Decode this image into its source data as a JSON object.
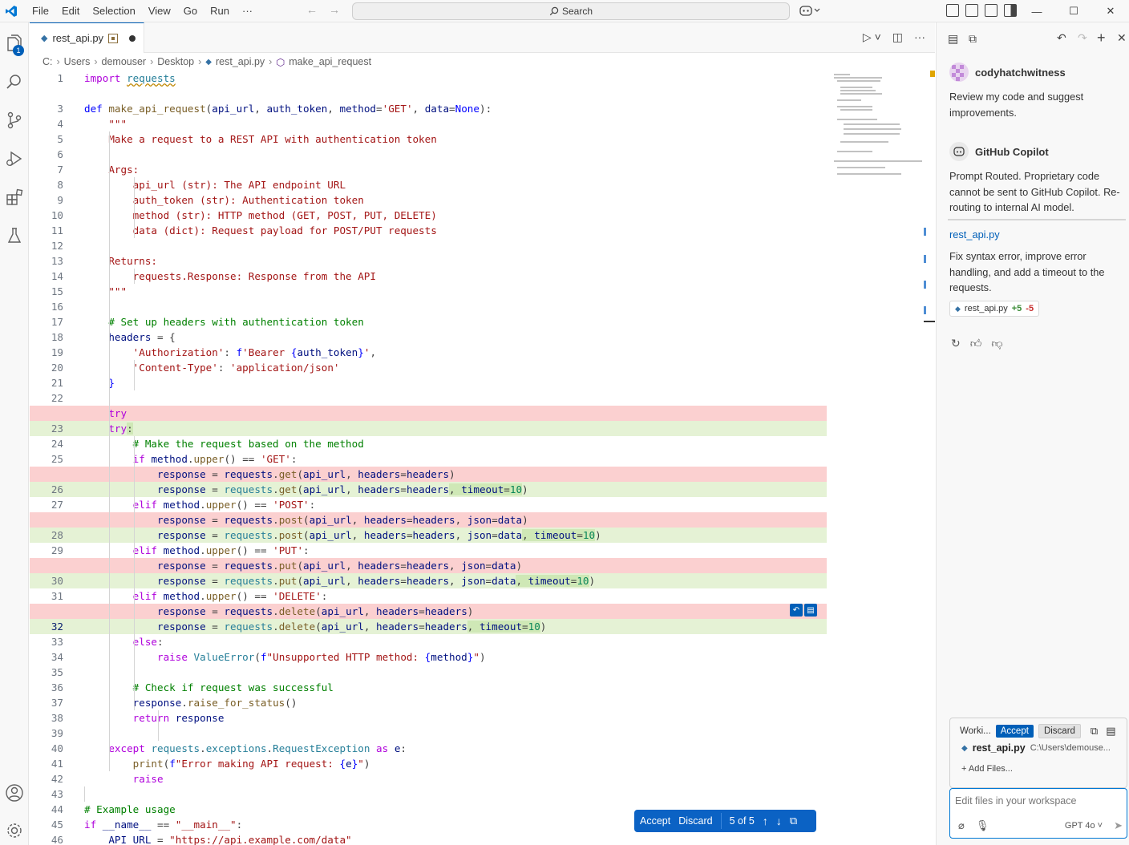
{
  "menu": [
    "File",
    "Edit",
    "Selection",
    "View",
    "Go",
    "Run",
    "···"
  ],
  "search": {
    "label": "Search"
  },
  "activity": {
    "explorer_badge": "1"
  },
  "tab": {
    "filename": "rest_api.py"
  },
  "breadcrumb": [
    "C:",
    "Users",
    "demouser",
    "Desktop",
    "rest_api.py",
    "make_api_request"
  ],
  "code": [
    {
      "n": "1",
      "t": "plain",
      "h": "<span class=\"kw\">import</span> <span class=\"cls squiggle\">requests</span>"
    },
    {
      "n": "",
      "t": "blank",
      "h": ""
    },
    {
      "n": "3",
      "t": "plain",
      "h": "<span class=\"kwb\">def</span> <span class=\"fn\">make_api_request</span>(<span class=\"var\">api_url</span>, <span class=\"var\">auth_token</span>, <span class=\"var\">method</span>=<span class=\"str\">'GET'</span>, <span class=\"var\">data</span>=<span class=\"kwb\">None</span>):"
    },
    {
      "n": "4",
      "t": "plain",
      "h": "    <span class=\"str\">\"\"\"</span>"
    },
    {
      "n": "5",
      "t": "plain",
      "h": "    <span class=\"str\">Make a request to a REST API with authentication token</span>"
    },
    {
      "n": "6",
      "t": "plain",
      "h": ""
    },
    {
      "n": "7",
      "t": "plain",
      "h": "    <span class=\"str\">Args:</span>"
    },
    {
      "n": "8",
      "t": "plain",
      "h": "        <span class=\"str\">api_url (str): The API endpoint URL</span>"
    },
    {
      "n": "9",
      "t": "plain",
      "h": "        <span class=\"str\">auth_token (str): Authentication token</span>"
    },
    {
      "n": "10",
      "t": "plain",
      "h": "        <span class=\"str\">method (str): HTTP method (GET, POST, PUT, DELETE)</span>"
    },
    {
      "n": "11",
      "t": "plain",
      "h": "        <span class=\"str\">data (dict): Request payload for POST/PUT requests</span>"
    },
    {
      "n": "12",
      "t": "plain",
      "h": ""
    },
    {
      "n": "13",
      "t": "plain",
      "h": "    <span class=\"str\">Returns:</span>"
    },
    {
      "n": "14",
      "t": "plain",
      "h": "        <span class=\"str\">requests.Response: Response from the API</span>"
    },
    {
      "n": "15",
      "t": "plain",
      "h": "    <span class=\"str\">\"\"\"</span>"
    },
    {
      "n": "16",
      "t": "plain",
      "h": ""
    },
    {
      "n": "17",
      "t": "plain",
      "h": "    <span class=\"cmt\"># Set up headers with authentication token</span>"
    },
    {
      "n": "18",
      "t": "plain",
      "h": "    <span class=\"var\">headers</span> = {"
    },
    {
      "n": "19",
      "t": "plain",
      "h": "        <span class=\"str\">'Authorization'</span>: <span class=\"kwb\">f</span><span class=\"str\">'Bearer </span><span class=\"kwb\">{</span><span class=\"var\">auth_token</span><span class=\"kwb\">}</span><span class=\"str\">'</span>,"
    },
    {
      "n": "20",
      "t": "plain",
      "h": "        <span class=\"str\">'Content-Type'</span>: <span class=\"str\">'application/json'</span>"
    },
    {
      "n": "21",
      "t": "plain",
      "h": "    <span class=\"kwb\">}</span>"
    },
    {
      "n": "22",
      "t": "plain",
      "h": ""
    },
    {
      "n": "",
      "t": "del",
      "h": "    <span class=\"kw\">try</span>"
    },
    {
      "n": "23",
      "t": "add",
      "h": "    <span class=\"kw\">try</span><span class=\"hl-add\">:</span>"
    },
    {
      "n": "24",
      "t": "plain",
      "h": "        <span class=\"cmt\"># Make the request based on the method</span>"
    },
    {
      "n": "25",
      "t": "plain",
      "h": "        <span class=\"kw\">if</span> <span class=\"var\">method</span>.<span class=\"fn\">upper</span>() == <span class=\"str\">'GET'</span>:"
    },
    {
      "n": "",
      "t": "del",
      "h": "            <span class=\"var\">response</span> = <span class=\"var\">requests</span>.<span class=\"fn\">get</span>(<span class=\"var\">api_url</span>, <span class=\"var\">headers</span>=<span class=\"var\">headers</span>)"
    },
    {
      "n": "26",
      "t": "add",
      "h": "            <span class=\"var\">response</span> = <span class=\"cls\">requests</span>.<span class=\"fn\">get</span>(<span class=\"var\">api_url</span>, <span class=\"var\">headers</span>=<span class=\"var\">headers</span><span class=\"hl-add\">, <span class=\"var\">timeout</span>=<span class=\"num\">10</span></span>)"
    },
    {
      "n": "27",
      "t": "plain",
      "h": "        <span class=\"kw\">elif</span> <span class=\"var\">method</span>.<span class=\"fn\">upper</span>() == <span class=\"str\">'POST'</span>:"
    },
    {
      "n": "",
      "t": "del",
      "h": "            <span class=\"var\">response</span> = <span class=\"var\">requests</span>.<span class=\"fn\">post</span>(<span class=\"var\">api_url</span>, <span class=\"var\">headers</span>=<span class=\"var\">headers</span>, <span class=\"var\">json</span>=<span class=\"var\">data</span>)"
    },
    {
      "n": "28",
      "t": "add",
      "h": "            <span class=\"var\">response</span> = <span class=\"cls\">requests</span>.<span class=\"fn\">post</span>(<span class=\"var\">api_url</span>, <span class=\"var\">headers</span>=<span class=\"var\">headers</span>, <span class=\"var\">json</span>=<span class=\"var\">data</span><span class=\"hl-add\">, <span class=\"var\">timeout</span>=<span class=\"num\">10</span></span>)"
    },
    {
      "n": "29",
      "t": "plain",
      "h": "        <span class=\"kw\">elif</span> <span class=\"var\">method</span>.<span class=\"fn\">upper</span>() == <span class=\"str\">'PUT'</span>:"
    },
    {
      "n": "",
      "t": "del",
      "h": "            <span class=\"var\">response</span> = <span class=\"var\">requests</span>.<span class=\"fn\">put</span>(<span class=\"var\">api_url</span>, <span class=\"var\">headers</span>=<span class=\"var\">headers</span>, <span class=\"var\">json</span>=<span class=\"var\">data</span>)"
    },
    {
      "n": "30",
      "t": "add",
      "h": "            <span class=\"var\">response</span> = <span class=\"cls\">requests</span>.<span class=\"fn\">put</span>(<span class=\"var\">api_url</span>, <span class=\"var\">headers</span>=<span class=\"var\">headers</span>, <span class=\"var\">json</span>=<span class=\"var\">data</span><span class=\"hl-add\">, <span class=\"var\">timeout</span>=<span class=\"num\">10</span></span>)"
    },
    {
      "n": "31",
      "t": "plain",
      "h": "        <span class=\"kw\">elif</span> <span class=\"var\">method</span>.<span class=\"fn\">upper</span>() == <span class=\"str\">'DELETE'</span>:"
    },
    {
      "n": "",
      "t": "del",
      "h": "            <span class=\"var\">response</span> = <span class=\"var\">requests</span>.<span class=\"fn\">delete</span>(<span class=\"var\">api_url</span>, <span class=\"var\">headers</span>=<span class=\"var\">headers</span>)"
    },
    {
      "n": "32",
      "t": "add",
      "active": true,
      "h": "            <span class=\"var\">response</span> = <span class=\"cls\">requests</span>.<span class=\"fn\">delete</span>(<span class=\"var\">api_url</span>, <span class=\"var\">headers</span>=<span class=\"var\">headers</span><span class=\"hl-add\">, <span class=\"var\">timeout</span>=<span class=\"num\">10</span></span>)"
    },
    {
      "n": "33",
      "t": "plain",
      "h": "        <span class=\"kw\">else</span>:"
    },
    {
      "n": "34",
      "t": "plain",
      "h": "            <span class=\"kw\">raise</span> <span class=\"cls\">ValueError</span>(<span class=\"kwb\">f</span><span class=\"str\">\"Unsupported HTTP method: </span><span class=\"kwb\">{</span><span class=\"var\">method</span><span class=\"kwb\">}</span><span class=\"str\">\"</span>)"
    },
    {
      "n": "35",
      "t": "plain",
      "h": ""
    },
    {
      "n": "36",
      "t": "plain",
      "h": "        <span class=\"cmt\"># Check if request was successful</span>"
    },
    {
      "n": "37",
      "t": "plain",
      "h": "        <span class=\"var\">response</span>.<span class=\"fn\">raise_for_status</span>()"
    },
    {
      "n": "38",
      "t": "plain",
      "h": "        <span class=\"kw\">return</span> <span class=\"var\">response</span>"
    },
    {
      "n": "39",
      "t": "plain",
      "h": ""
    },
    {
      "n": "40",
      "t": "plain",
      "h": "    <span class=\"kw\">except</span> <span class=\"cls\">requests</span>.<span class=\"cls\">exceptions</span>.<span class=\"cls\">RequestException</span> <span class=\"kw\">as</span> <span class=\"var\">e</span>:"
    },
    {
      "n": "41",
      "t": "plain",
      "h": "        <span class=\"fn\">print</span>(<span class=\"kwb\">f</span><span class=\"str\">\"Error making API request: </span><span class=\"kwb\">{</span><span class=\"var\">e</span><span class=\"kwb\">}</span><span class=\"str\">\"</span>)"
    },
    {
      "n": "42",
      "t": "plain",
      "h": "        <span class=\"kw\">raise</span>"
    },
    {
      "n": "43",
      "t": "plain",
      "h": ""
    },
    {
      "n": "44",
      "t": "plain",
      "h": "<span class=\"cmt\"># Example usage</span>"
    },
    {
      "n": "45",
      "t": "plain",
      "h": "<span class=\"kw\">if</span> <span class=\"var\">__name__</span> == <span class=\"str\">\"__main__\"</span>:"
    },
    {
      "n": "46",
      "t": "plain",
      "h": "    <span class=\"var\">API_URL</span> = <span class=\"str\">\"https://api.example.com/data\"</span>"
    }
  ],
  "diff_toolbar": {
    "accept": "Accept",
    "discard": "Discard",
    "counter": "5 of 5"
  },
  "chat": {
    "user_name": "codyhatchwitness",
    "user_message": "Review my code and suggest improvements.",
    "bot_name": "GitHub Copilot",
    "bot_message": "Prompt Routed. Proprietary code cannot be sent to GitHub Copilot. Re-routing to internal AI model.",
    "file_link": "rest_api.py",
    "summary": "Fix syntax error, improve error handling, and add a timeout to the requests.",
    "chip_file": "rest_api.py",
    "chip_add": "+5",
    "chip_del": "-5",
    "working_label": "Worki...",
    "accept": "Accept",
    "discard": "Discard",
    "working_file": "rest_api.py",
    "working_path": "C:\\Users\\demouse...",
    "add_files": "+ Add Files...",
    "input_placeholder": "Edit files in your workspace",
    "model": "GPT 4o"
  },
  "colors": {
    "accent": "#005fb8",
    "deleted_line": "#fbd0d0",
    "added_line": "#e5f2d5"
  }
}
